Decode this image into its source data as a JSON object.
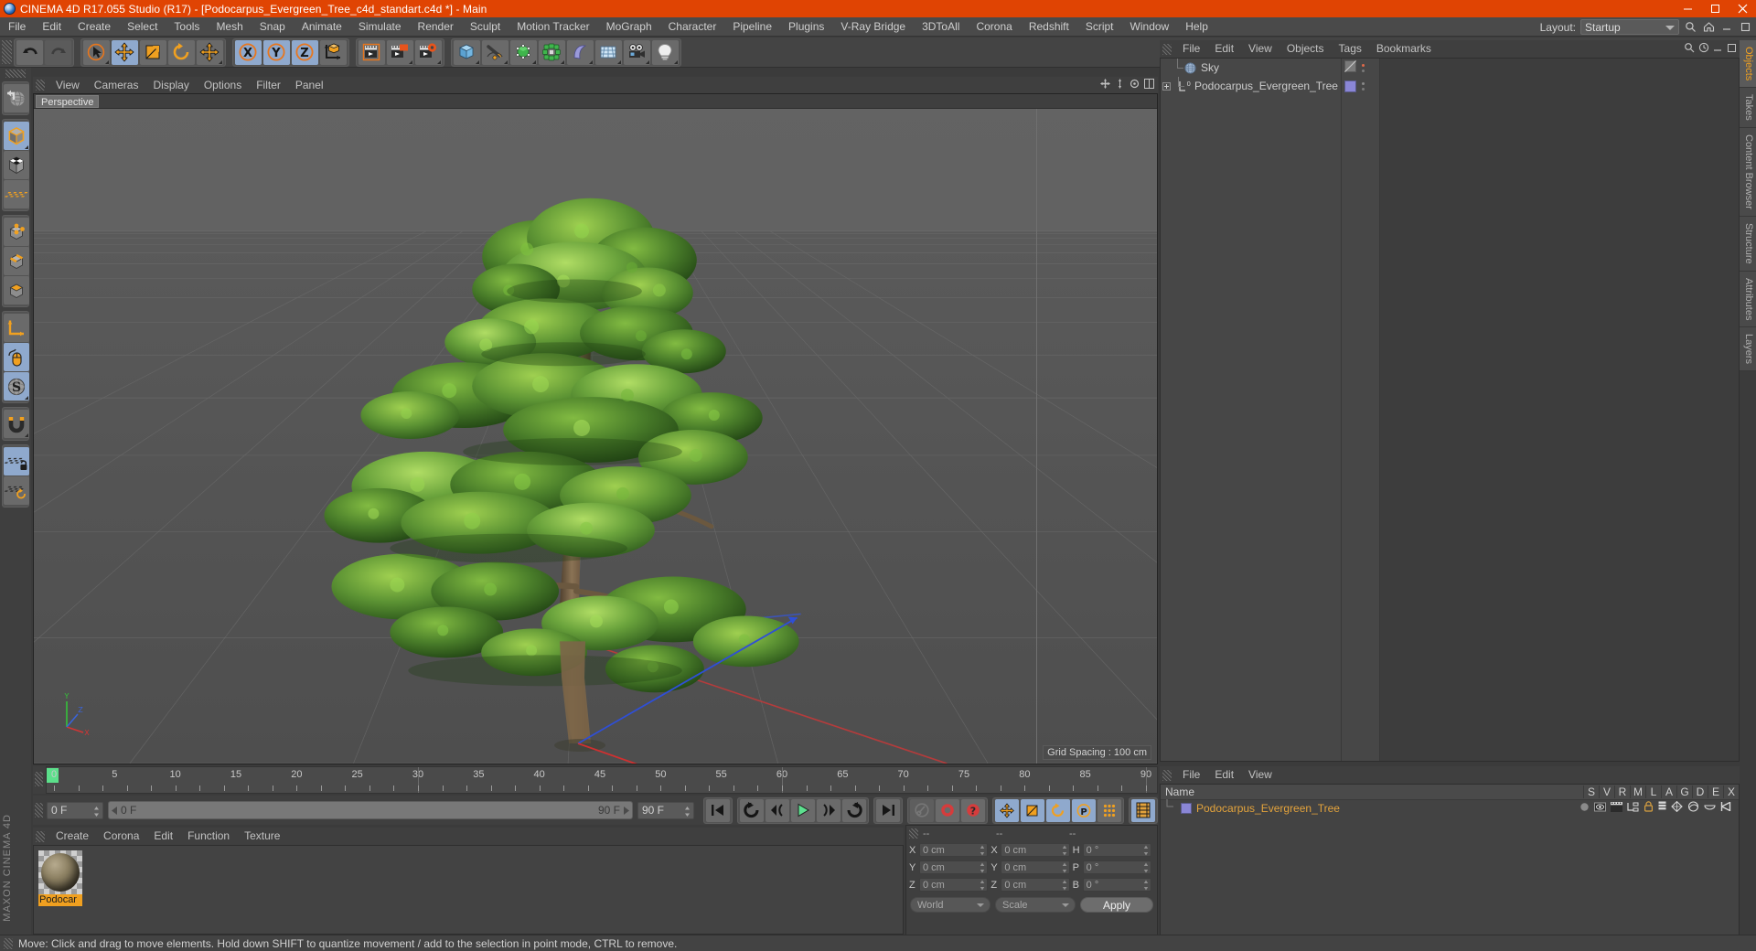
{
  "window": {
    "title": "CINEMA 4D R17.055 Studio (R17) - [Podocarpus_Evergreen_Tree_c4d_standart.c4d *] - Main",
    "logo_name": "cinema4d-logo",
    "minimize": "─",
    "maximize": "□",
    "close": "✕",
    "accent_color": "#e04403",
    "bg_color": "#3b3b3b"
  },
  "menubar": {
    "items": [
      "File",
      "Edit",
      "Create",
      "Select",
      "Tools",
      "Mesh",
      "Snap",
      "Animate",
      "Simulate",
      "Render",
      "Sculpt",
      "Motion Tracker",
      "MoGraph",
      "Character",
      "Pipeline",
      "Plugins",
      "V-Ray Bridge",
      "3DToAll",
      "Corona",
      "Redshift",
      "Script",
      "Window",
      "Help"
    ],
    "layout_label": "Layout:",
    "layout_value": "Startup"
  },
  "toolbar": {
    "groups": [
      {
        "name": "history",
        "buttons": [
          {
            "icon": "undo-icon",
            "label": "Undo",
            "state": "normal"
          },
          {
            "icon": "redo-icon",
            "label": "Redo",
            "state": "disabled"
          }
        ]
      },
      {
        "name": "transform",
        "buttons": [
          {
            "icon": "live-selection-icon",
            "label": "Live Selection",
            "state": "normal"
          },
          {
            "icon": "move-icon",
            "label": "Move",
            "state": "selected"
          },
          {
            "icon": "scale-icon",
            "label": "Scale",
            "state": "normal"
          },
          {
            "icon": "rotate-icon",
            "label": "Rotate",
            "state": "normal"
          },
          {
            "icon": "move-free-icon",
            "label": "Move Free",
            "state": "normal"
          }
        ]
      },
      {
        "name": "axis-locks",
        "buttons": [
          {
            "icon": "axis-x-icon",
            "label": "X Axis",
            "state": "selected"
          },
          {
            "icon": "axis-y-icon",
            "label": "Y Axis",
            "state": "selected"
          },
          {
            "icon": "axis-z-icon",
            "label": "Z Axis",
            "state": "selected"
          },
          {
            "icon": "world-coordinate-icon",
            "label": "World/Object",
            "state": "normal"
          }
        ]
      },
      {
        "name": "render",
        "buttons": [
          {
            "icon": "render-view-icon",
            "label": "Render View",
            "state": "normal"
          },
          {
            "icon": "render-picture-viewer-icon",
            "label": "Render to Picture Viewer",
            "state": "normal"
          },
          {
            "icon": "render-settings-icon",
            "label": "Edit Render Settings",
            "state": "normal"
          }
        ]
      },
      {
        "name": "objects",
        "buttons": [
          {
            "icon": "cube-primitive-icon",
            "label": "Add Cube Object",
            "state": "normal"
          },
          {
            "icon": "spline-pen-icon",
            "label": "Add Spline Object",
            "state": "normal"
          },
          {
            "icon": "generator-icon",
            "label": "Add Generator Object",
            "state": "normal"
          },
          {
            "icon": "array-icon",
            "label": "Add Modelling Object",
            "state": "normal"
          },
          {
            "icon": "bend-deformer-icon",
            "label": "Add Deformer Object",
            "state": "normal"
          },
          {
            "icon": "floor-environment-icon",
            "label": "Add Scene Object",
            "state": "normal"
          },
          {
            "icon": "camera-icon",
            "label": "Add Camera Object",
            "state": "normal"
          },
          {
            "icon": "light-icon",
            "label": "Add Light Object",
            "state": "normal"
          }
        ]
      }
    ]
  },
  "left_palette": {
    "groups": [
      {
        "name": "undo-view",
        "buttons": [
          {
            "icon": "undo-view-icon",
            "label": "Undo View",
            "state": "normal"
          }
        ]
      },
      {
        "name": "model-modes",
        "buttons": [
          {
            "icon": "model-mode-icon",
            "label": "Model Mode",
            "state": "selected"
          },
          {
            "icon": "texture-mode-icon",
            "label": "Texture Mode",
            "state": "normal"
          },
          {
            "icon": "workplane-mode-icon",
            "label": "Workplane Mode",
            "state": "normal"
          }
        ]
      },
      {
        "name": "component-modes",
        "buttons": [
          {
            "icon": "points-mode-icon",
            "label": "Points Mode",
            "state": "normal"
          },
          {
            "icon": "edges-mode-icon",
            "label": "Edges Mode",
            "state": "normal"
          },
          {
            "icon": "polygons-mode-icon",
            "label": "Polygons Mode",
            "state": "normal"
          }
        ]
      },
      {
        "name": "axis-tools",
        "buttons": [
          {
            "icon": "enable-axis-icon",
            "label": "Enable Axis Modification",
            "state": "normal"
          },
          {
            "icon": "viewport-solo-icon",
            "label": "Viewport Solo",
            "state": "selected"
          },
          {
            "icon": "soft-selection-icon",
            "label": "Enable Snapping",
            "state": "selected"
          }
        ]
      },
      {
        "name": "snap",
        "buttons": [
          {
            "icon": "magnet-icon",
            "label": "Magnet",
            "state": "normal"
          }
        ]
      },
      {
        "name": "workplane",
        "buttons": [
          {
            "icon": "workplane-lock-icon",
            "label": "Lock Workplane",
            "state": "selected"
          },
          {
            "icon": "workplane-rotate-icon",
            "label": "Planar Workplane",
            "state": "normal"
          }
        ]
      }
    ],
    "brand": "MAXON CINEMA 4D"
  },
  "viewport": {
    "menu": [
      "View",
      "Cameras",
      "Display",
      "Options",
      "Filter",
      "Panel"
    ],
    "tab_label": "Perspective",
    "grid_spacing": "Grid Spacing : 100 cm",
    "corner_icons": [
      "move-view-icon",
      "scale-view-icon",
      "rotate-view-icon",
      "maximize-view-icon"
    ],
    "axis_labels": {
      "x": "X",
      "y": "Y",
      "z": "Z"
    },
    "scene_object": "Podocarpus Evergreen Tree"
  },
  "object_manager": {
    "menu": [
      "File",
      "Edit",
      "View",
      "Objects",
      "Tags",
      "Bookmarks"
    ],
    "tools": [
      "search-icon",
      "history-icon",
      "minimize-icon",
      "maximize-icon"
    ],
    "items": [
      {
        "name": "Sky",
        "icon": "sky-icon",
        "tag_color": "",
        "has_expander": false,
        "visible_dot": "#e06a4a"
      },
      {
        "name": "Podocarpus_Evergreen_Tree",
        "icon": "null-object-icon",
        "tag_color": "#8a86d6",
        "has_expander": true,
        "visible_dot": "#8a8a8a"
      }
    ]
  },
  "timeline": {
    "ticks": [
      0,
      5,
      10,
      15,
      20,
      25,
      30,
      35,
      40,
      45,
      50,
      55,
      60,
      65,
      70,
      75,
      80,
      85,
      90
    ],
    "min_frame": 0,
    "max_frame": 90,
    "current_frame_label": "0 F",
    "end_field_label": "0 F",
    "range_start_label": "0 F",
    "range_end_label": "90 F",
    "doc_end_label": "90 F",
    "playhead_frame": 0
  },
  "playback": {
    "buttons": [
      {
        "icon": "go-to-start-icon",
        "label": "Go to Start",
        "state": "normal"
      },
      {
        "icon": "previous-keyframe-icon",
        "label": "Go to Previous Key",
        "state": "normal"
      },
      {
        "icon": "previous-frame-icon",
        "label": "Go to Previous Frame",
        "state": "normal"
      },
      {
        "icon": "play-icon",
        "label": "Play Forwards",
        "state": "normal"
      },
      {
        "icon": "next-frame-icon",
        "label": "Go to Next Frame",
        "state": "normal"
      },
      {
        "icon": "next-keyframe-icon",
        "label": "Go to Next Key",
        "state": "normal"
      },
      {
        "icon": "go-to-end-icon",
        "label": "Go to End",
        "state": "normal"
      }
    ],
    "record_group": [
      {
        "icon": "autokey-icon",
        "label": "Autokeying",
        "state": "disabled"
      },
      {
        "icon": "record-icon",
        "label": "Record Active Objects",
        "state": "normal"
      },
      {
        "icon": "keyframe-selection-icon",
        "label": "Keyframe Selection",
        "state": "normal"
      }
    ],
    "key_group": [
      {
        "icon": "position-key-icon",
        "label": "Position",
        "state": "selected"
      },
      {
        "icon": "scale-key-icon",
        "label": "Scale",
        "state": "selected"
      },
      {
        "icon": "rotation-key-icon",
        "label": "Rotation",
        "state": "selected"
      },
      {
        "icon": "param-key-icon",
        "label": "Parameter",
        "state": "selected"
      },
      {
        "icon": "point-level-icon",
        "label": "Point Level Animation",
        "state": "normal"
      }
    ],
    "extra": [
      {
        "icon": "timeline-icon",
        "label": "Timeline",
        "state": "selected"
      }
    ]
  },
  "material_manager": {
    "menu": [
      "Create",
      "Corona",
      "Edit",
      "Function",
      "Texture"
    ],
    "materials": [
      {
        "name": "Podocar",
        "full_name": "Podocarpus",
        "selected": true
      }
    ]
  },
  "coordinates": {
    "headers": [
      "--",
      "--",
      "--"
    ],
    "rows": [
      {
        "label_pos": "X",
        "value_pos": "0 cm",
        "label_size": "X",
        "value_size": "0 cm",
        "label_rot": "H",
        "value_rot": "0 °"
      },
      {
        "label_pos": "Y",
        "value_pos": "0 cm",
        "label_size": "Y",
        "value_size": "0 cm",
        "label_rot": "P",
        "value_rot": "0 °"
      },
      {
        "label_pos": "Z",
        "value_pos": "0 cm",
        "label_size": "Z",
        "value_size": "0 cm",
        "label_rot": "B",
        "value_rot": "0 °"
      }
    ],
    "system": "World",
    "mode": "Scale",
    "apply": "Apply"
  },
  "attribute_dock": {
    "menu": [
      "File",
      "Edit",
      "View"
    ],
    "columns": [
      "Name",
      "S",
      "V",
      "R",
      "M",
      "L",
      "A",
      "G",
      "D",
      "E",
      "X"
    ],
    "rows": [
      {
        "name": "Podocarpus_Evergreen_Tree",
        "color": "#8a86d6"
      }
    ],
    "tag_icons": [
      "dot-icon",
      "display-tag-icon",
      "render-tag-icon",
      "compositing-tag-icon",
      "lock-icon",
      "layer-icon",
      "generator-icon",
      "phong-tag-icon",
      "cap-icon",
      "xref-icon"
    ]
  },
  "right_tabs": [
    {
      "label": "Objects",
      "active": true
    },
    {
      "label": "Takes",
      "active": false
    },
    {
      "label": "Content Browser",
      "active": false
    },
    {
      "label": "Structure",
      "active": false
    },
    {
      "label": "Attributes",
      "active": false
    },
    {
      "label": "Layers",
      "active": false
    }
  ],
  "statusbar": {
    "text": "Move: Click and drag to move elements. Hold down SHIFT to quantize movement / add to the selection in point mode, CTRL to remove."
  }
}
